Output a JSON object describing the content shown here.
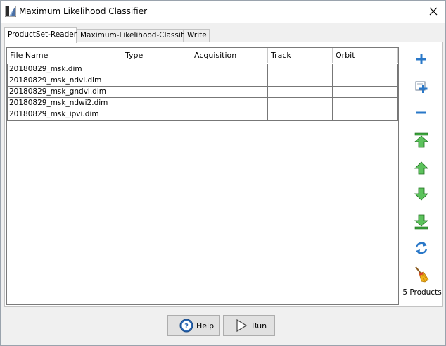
{
  "window": {
    "title": "Maximum Likelihood Classifier"
  },
  "tabs": [
    {
      "label": "ProductSet-Reader",
      "active": true
    },
    {
      "label": "Maximum-Likelihood-Classifier",
      "active": false
    },
    {
      "label": "Write",
      "active": false
    }
  ],
  "table": {
    "columns": [
      "File Name",
      "Type",
      "Acquisition",
      "Track",
      "Orbit"
    ],
    "rows": [
      [
        "20180829_msk.dim",
        "",
        "",
        "",
        ""
      ],
      [
        "20180829_msk_ndvi.dim",
        "",
        "",
        "",
        ""
      ],
      [
        "20180829_msk_gndvi.dim",
        "",
        "",
        "",
        ""
      ],
      [
        "20180829_msk_ndwi2.dim",
        "",
        "",
        "",
        ""
      ],
      [
        "20180829_msk_ipvi.dim",
        "",
        "",
        "",
        ""
      ]
    ]
  },
  "side_buttons": [
    {
      "icon": "add-icon"
    },
    {
      "icon": "add-all-icon"
    },
    {
      "icon": "remove-icon"
    },
    {
      "icon": "move-top-icon"
    },
    {
      "icon": "move-up-icon"
    },
    {
      "icon": "move-down-icon"
    },
    {
      "icon": "move-bottom-icon"
    },
    {
      "icon": "refresh-icon"
    },
    {
      "icon": "clear-icon"
    }
  ],
  "product_count": "5 Products",
  "buttons": {
    "help": "Help",
    "run": "Run"
  },
  "colors": {
    "accent_blue": "#2a78c8",
    "accent_green": "#3aa53a"
  }
}
